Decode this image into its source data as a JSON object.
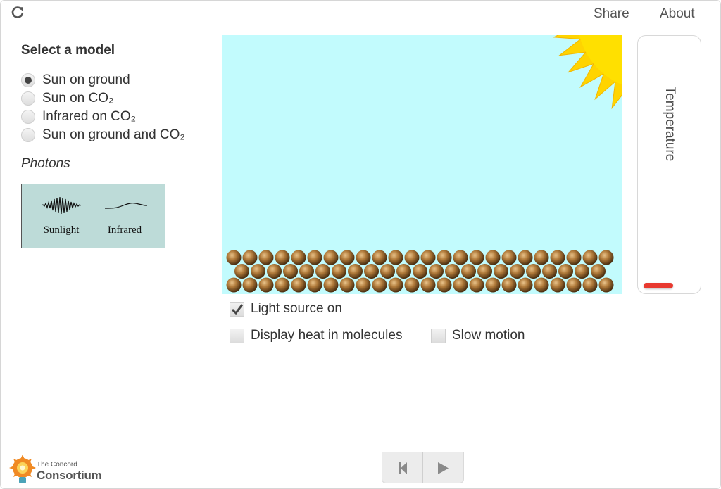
{
  "header": {
    "share_label": "Share",
    "about_label": "About"
  },
  "model_select": {
    "title": "Select a model",
    "selected_index": 0,
    "options": [
      {
        "label": "Sun on ground"
      },
      {
        "label": "Sun on CO₂"
      },
      {
        "label": "Infrared on CO₂"
      },
      {
        "label": "Sun on ground and CO₂"
      }
    ]
  },
  "photons": {
    "title": "Photons",
    "legend": [
      {
        "label": "Sunlight",
        "icon": "sunlight-wave-icon"
      },
      {
        "label": "Infrared",
        "icon": "infrared-wave-icon"
      }
    ]
  },
  "simulation": {
    "sky_color": "#c2fbfd",
    "sun_color": "#ffd400",
    "molecule_color": "#8a5a24",
    "ground_rows": [
      {
        "count": 24
      },
      {
        "count": 23
      },
      {
        "count": 24
      }
    ]
  },
  "thermometer": {
    "label": "Temperature",
    "level": 0.02,
    "bar_color": "#e8392f"
  },
  "options": {
    "light_source": {
      "label": "Light source on",
      "checked": true
    },
    "display_heat": {
      "label": "Display heat in molecules",
      "checked": false
    },
    "slow_motion": {
      "label": "Slow motion",
      "checked": false
    }
  },
  "footer": {
    "logo_line1": "The Concord",
    "logo_line2": "Consortium",
    "controls": [
      {
        "icon": "reset-icon"
      },
      {
        "icon": "play-icon"
      }
    ]
  }
}
